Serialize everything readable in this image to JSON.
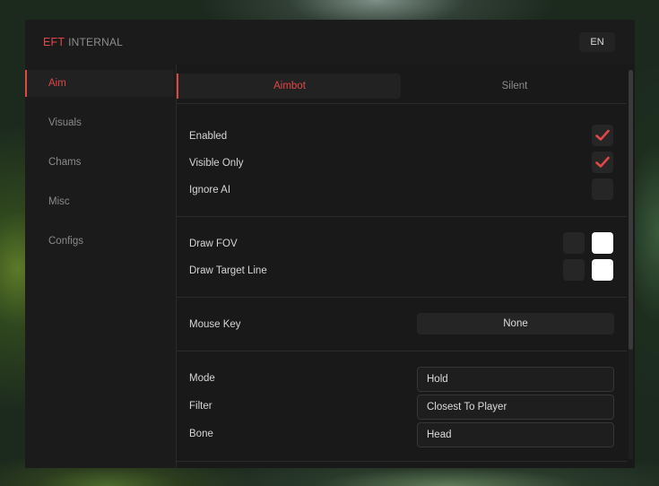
{
  "titlebar": {
    "brand_accent": "EFT",
    "brand_rest": "INTERNAL",
    "language_button": "EN"
  },
  "sidebar": {
    "items": [
      {
        "label": "Aim",
        "active": true
      },
      {
        "label": "Visuals",
        "active": false
      },
      {
        "label": "Chams",
        "active": false
      },
      {
        "label": "Misc",
        "active": false
      },
      {
        "label": "Configs",
        "active": false
      }
    ]
  },
  "tabs": [
    {
      "label": "Aimbot",
      "active": true
    },
    {
      "label": "Silent",
      "active": false
    }
  ],
  "section1": {
    "enabled_label": "Enabled",
    "enabled_checked": true,
    "visible_only_label": "Visible Only",
    "visible_only_checked": true,
    "ignore_ai_label": "Ignore AI",
    "ignore_ai_checked": false
  },
  "section2": {
    "draw_fov_label": "Draw FOV",
    "draw_target_line_label": "Draw Target Line"
  },
  "section3": {
    "mouse_key_label": "Mouse Key",
    "mouse_key_value": "None"
  },
  "section4": {
    "mode_label": "Mode",
    "mode_value": "Hold",
    "filter_label": "Filter",
    "filter_value": "Closest To Player",
    "bone_label": "Bone",
    "bone_value": "Head"
  },
  "colors": {
    "accent": "#e04747",
    "window_bg": "#191919",
    "text_primary": "#d6d6d6",
    "text_muted": "#8b8b8b"
  },
  "icons": {
    "check": "checkmark-icon"
  }
}
